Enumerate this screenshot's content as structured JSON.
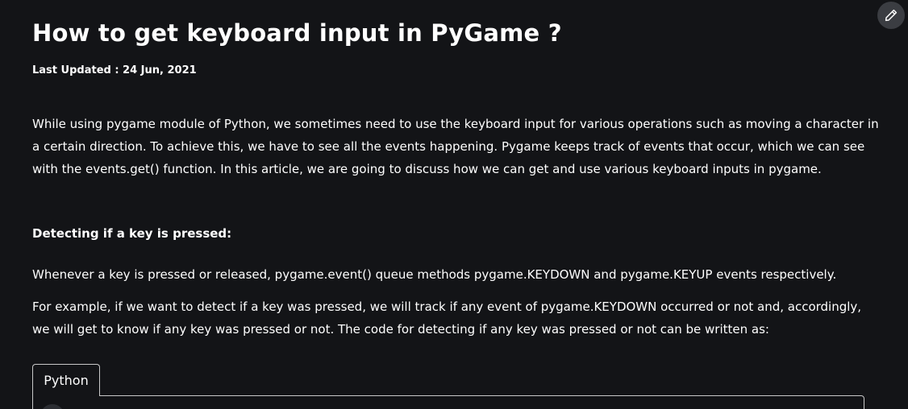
{
  "article": {
    "title": "How to get keyboard input in PyGame ?",
    "last_updated": "Last Updated : 24 Jun, 2021",
    "paragraphs": {
      "intro": "While using pygame module of Python, we sometimes need to use the keyboard input for various operations such as moving a character in a certain direction. To achieve this, we have to see all the events happening. Pygame keeps track of events that occur, which we can see with the events.get() function. In this article, we are going to discuss how we can get and use various keyboard inputs in pygame.",
      "heading": "Detecting if a key is pressed:",
      "events": "Whenever a key is pressed or released, pygame.event() queue methods pygame.KEYDOWN and pygame.KEYUP events respectively.",
      "example": "For example, if we want to detect if a key was pressed, we will track if any event of pygame.KEYDOWN occurred or not and, accordingly, we will get to know if any key was pressed or not. The code for detecting if any key was pressed or not can be written as:"
    }
  },
  "code_block": {
    "tab_label": "Python"
  },
  "icons": {
    "edit": "pencil-icon"
  },
  "colors": {
    "background": "#131417",
    "text": "#ffffff",
    "edit_button_bg": "#3b3d42",
    "code_border": "#c9c9c9"
  }
}
